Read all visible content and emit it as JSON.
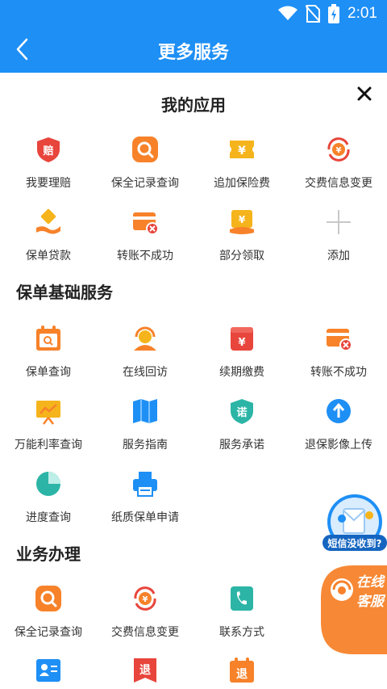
{
  "status": {
    "time": "2:01"
  },
  "header": {
    "title": "更多服务"
  },
  "my_apps": {
    "title": "我的应用",
    "items": [
      {
        "label": "我要理赔",
        "icon": "claim-shield-icon"
      },
      {
        "label": "保全记录查询",
        "icon": "search-icon"
      },
      {
        "label": "追加保险费",
        "icon": "yen-ticket-icon"
      },
      {
        "label": "交费信息变更",
        "icon": "yen-refresh-icon"
      },
      {
        "label": "保单贷款",
        "icon": "loan-hand-icon"
      },
      {
        "label": "转账不成功",
        "icon": "card-fail-icon"
      },
      {
        "label": "部分领取",
        "icon": "partial-withdraw-icon"
      },
      {
        "label": "添加",
        "icon": "plus-icon"
      }
    ]
  },
  "basic_services": {
    "title": "保单基础服务",
    "items": [
      {
        "label": "保单查询",
        "icon": "calendar-search-icon"
      },
      {
        "label": "在线回访",
        "icon": "headset-person-icon"
      },
      {
        "label": "续期缴费",
        "icon": "yen-wallet-icon"
      },
      {
        "label": "转账不成功",
        "icon": "card-fail-icon"
      },
      {
        "label": "万能利率查询",
        "icon": "rate-board-icon"
      },
      {
        "label": "服务指南",
        "icon": "map-guide-icon"
      },
      {
        "label": "服务承诺",
        "icon": "promise-shield-icon"
      },
      {
        "label": "退保影像上传",
        "icon": "upload-icon"
      },
      {
        "label": "进度查询",
        "icon": "progress-pie-icon"
      },
      {
        "label": "纸质保单申请",
        "icon": "printer-icon"
      }
    ]
  },
  "business": {
    "title": "业务办理",
    "items": [
      {
        "label": "保全记录查询",
        "icon": "search-icon"
      },
      {
        "label": "交费信息变更",
        "icon": "yen-refresh-icon"
      },
      {
        "label": "联系方式",
        "icon": "phone-book-icon"
      },
      {
        "label": "",
        "icon": "contact-card-icon"
      },
      {
        "label": "退",
        "icon": "surrender-flag-icon"
      },
      {
        "label": "退",
        "icon": "surrender-calendar-icon"
      }
    ]
  },
  "floating": {
    "sms_label": "短信没收到?",
    "cs_line1": "在线",
    "cs_line2": "客服"
  },
  "colors": {
    "primary": "#1e8ff5",
    "orange": "#f7822a",
    "red": "#e8453c",
    "yellow": "#f5b41b",
    "teal": "#2cb5a6"
  }
}
